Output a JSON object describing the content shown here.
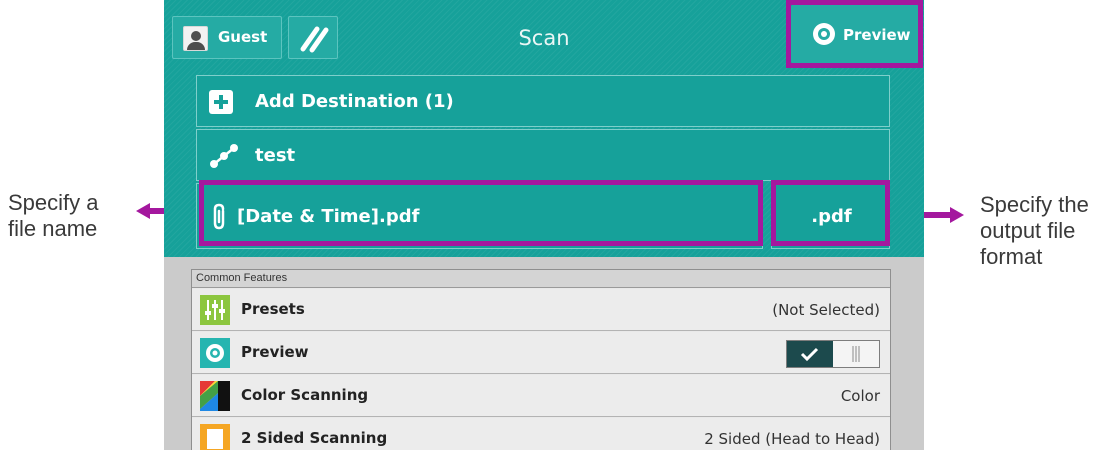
{
  "callouts": {
    "left_line1": "Specify a",
    "left_line2": "file name",
    "right_line1": "Specify the",
    "right_line2": "output file",
    "right_line3": "format"
  },
  "header": {
    "user_label": "Guest",
    "title": "Scan",
    "preview_label": "Preview"
  },
  "destinations": {
    "add_label": "Add Destination (1)",
    "destination_name": "test"
  },
  "file": {
    "name": "[Date & Time].pdf",
    "format": ".pdf"
  },
  "features": {
    "section_title": "Common Features",
    "items": [
      {
        "label": "Presets",
        "value": "(Not Selected)",
        "icon": "presets-icon"
      },
      {
        "label": "Preview",
        "value": "on",
        "icon": "preview-eye-icon"
      },
      {
        "label": "Color Scanning",
        "value": "Color",
        "icon": "color-scanning-icon"
      },
      {
        "label": "2 Sided Scanning",
        "value": "2 Sided (Head to Head)",
        "icon": "two-sided-icon"
      }
    ]
  },
  "colors": {
    "panel_teal": "#16a19a",
    "highlight_magenta": "#a4189e",
    "toggle_dark": "#1c4a4d"
  }
}
